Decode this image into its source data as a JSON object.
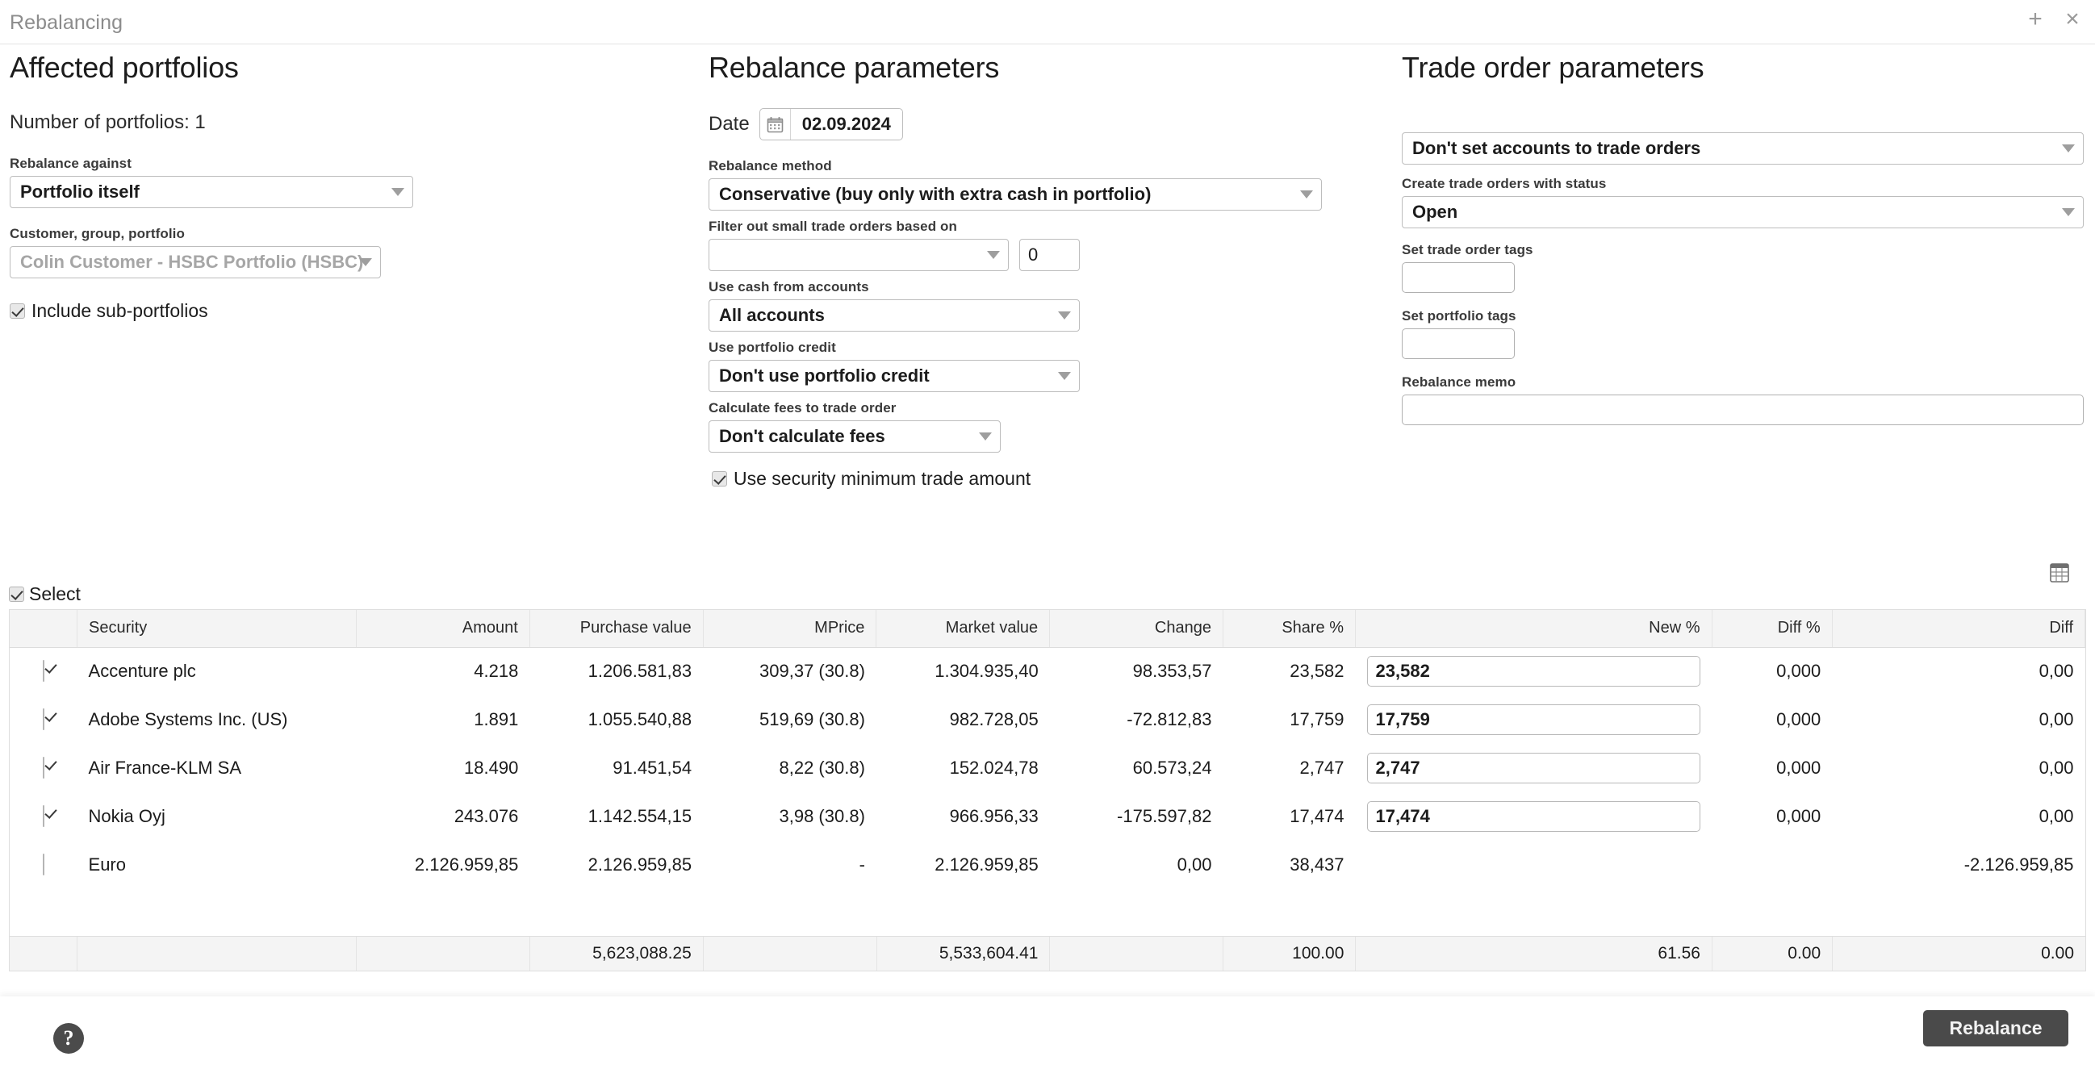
{
  "window": {
    "title": "Rebalancing",
    "add_icon": "+",
    "close_icon": "×"
  },
  "affected": {
    "title": "Affected portfolios",
    "number_of_portfolios": "Number of portfolios: 1",
    "rebalance_against_label": "Rebalance against",
    "rebalance_against_value": "Portfolio itself",
    "customer_group_portfolio_label": "Customer, group, portfolio",
    "customer_group_portfolio_value": "Colin Customer - HSBC Portfolio (HSBC)",
    "include_sub_portfolios_label": "Include sub-portfolios",
    "include_sub_portfolios_checked": true
  },
  "rebalance": {
    "title": "Rebalance parameters",
    "date_label": "Date",
    "date_value": "02.09.2024",
    "method_label": "Rebalance method",
    "method_value": "Conservative (buy only with extra cash in portfolio)",
    "filter_label": "Filter out small trade orders based on",
    "filter_value": "",
    "filter_amount": "0",
    "use_cash_label": "Use cash from accounts",
    "use_cash_value": "All accounts",
    "portfolio_credit_label": "Use portfolio credit",
    "portfolio_credit_value": "Don't use portfolio credit",
    "fees_label": "Calculate fees to trade order",
    "fees_value": "Don't calculate fees",
    "min_trade_label": "Use security minimum trade amount",
    "min_trade_checked": true
  },
  "trade_order": {
    "title": "Trade order parameters",
    "accounts_value": "Don't set accounts to trade orders",
    "status_label": "Create trade orders with status",
    "status_value": "Open",
    "trade_order_tags_label": "Set trade order tags",
    "trade_order_tags_value": "",
    "portfolio_tags_label": "Set portfolio tags",
    "portfolio_tags_value": "",
    "memo_label": "Rebalance memo",
    "memo_value": ""
  },
  "table": {
    "select_all_label": "Select",
    "select_all_checked": true,
    "export_icon": "spreadsheet-export-icon",
    "columns": [
      "",
      "Security",
      "Amount",
      "Purchase value",
      "MPrice",
      "Market value",
      "Change",
      "Share %",
      "New %",
      "Diff %",
      "Diff"
    ],
    "rows": [
      {
        "checked": true,
        "security": "Accenture plc",
        "amount": "4.218",
        "purchase_value": "1.206.581,83",
        "mprice": "309,37 (30.8)",
        "market_value": "1.304.935,40",
        "change": "98.353,57",
        "share_pct": "23,582",
        "new_pct": "23,582",
        "has_new_input": true,
        "diff_pct": "0,000",
        "diff": "0,00"
      },
      {
        "checked": true,
        "security": "Adobe Systems Inc. (US)",
        "amount": "1.891",
        "purchase_value": "1.055.540,88",
        "mprice": "519,69 (30.8)",
        "market_value": "982.728,05",
        "change": "-72.812,83",
        "share_pct": "17,759",
        "new_pct": "17,759",
        "has_new_input": true,
        "diff_pct": "0,000",
        "diff": "0,00"
      },
      {
        "checked": true,
        "security": "Air France-KLM SA",
        "amount": "18.490",
        "purchase_value": "91.451,54",
        "mprice": "8,22 (30.8)",
        "market_value": "152.024,78",
        "change": "60.573,24",
        "share_pct": "2,747",
        "new_pct": "2,747",
        "has_new_input": true,
        "diff_pct": "0,000",
        "diff": "0,00"
      },
      {
        "checked": true,
        "security": "Nokia Oyj",
        "amount": "243.076",
        "purchase_value": "1.142.554,15",
        "mprice": "3,98 (30.8)",
        "market_value": "966.956,33",
        "change": "-175.597,82",
        "share_pct": "17,474",
        "new_pct": "17,474",
        "has_new_input": true,
        "diff_pct": "0,000",
        "diff": "0,00"
      },
      {
        "checked": false,
        "security": "Euro",
        "amount": "2.126.959,85",
        "purchase_value": "2.126.959,85",
        "mprice": "-",
        "market_value": "2.126.959,85",
        "change": "0,00",
        "share_pct": "38,437",
        "new_pct": "",
        "has_new_input": false,
        "diff_pct": "",
        "diff": "-2.126.959,85"
      }
    ],
    "totals": {
      "amount": "",
      "purchase_value": "5,623,088.25",
      "mprice": "",
      "market_value": "5,533,604.41",
      "change": "",
      "share_pct": "100.00",
      "new_pct": "61.56",
      "diff_pct": "0.00",
      "diff": "0.00"
    }
  },
  "footer": {
    "help_label": "?",
    "rebalance_button": "Rebalance"
  },
  "colors": {
    "accent_button": "#4a4a4a",
    "header_bg": "#f4f4f4",
    "border": "#dedede"
  }
}
